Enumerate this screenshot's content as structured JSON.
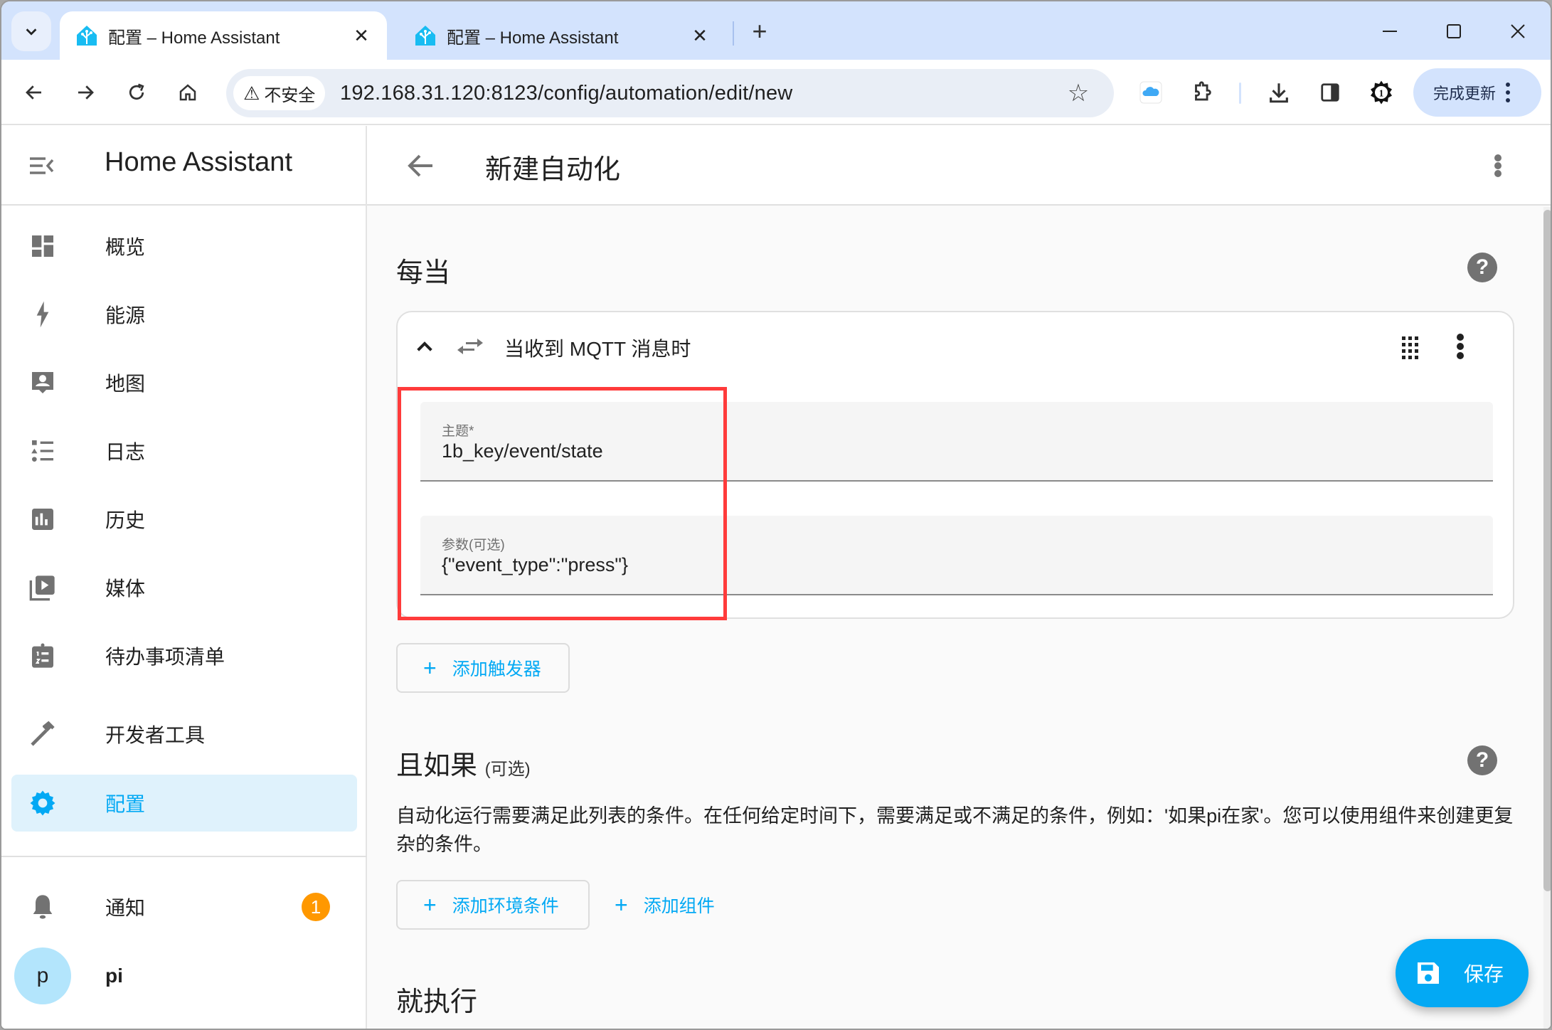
{
  "browser": {
    "tabs": [
      {
        "title": "配置 – Home Assistant",
        "active": true
      },
      {
        "title": "配置 – Home Assistant",
        "active": false
      }
    ],
    "new_tab_label": "+",
    "security_label": "不安全",
    "url": "192.168.31.120:8123/config/automation/edit/new",
    "update_button_label": "完成更新",
    "accent": "#d3e3fd"
  },
  "sidebar": {
    "title": "Home Assistant",
    "items": [
      {
        "label": "概览",
        "icon": "view-dashboard-icon"
      },
      {
        "label": "能源",
        "icon": "lightning-bolt-icon"
      },
      {
        "label": "地图",
        "icon": "account-box-map-icon"
      },
      {
        "label": "日志",
        "icon": "format-list-bulleted-type-icon"
      },
      {
        "label": "历史",
        "icon": "chart-box-icon"
      },
      {
        "label": "媒体",
        "icon": "play-box-multiple-icon"
      },
      {
        "label": "待办事项清单",
        "icon": "clipboard-list-icon"
      },
      {
        "label": "开发者工具",
        "icon": "hammer-icon"
      },
      {
        "label": "配置",
        "icon": "cog-icon",
        "selected": true
      }
    ],
    "notifications": {
      "label": "通知",
      "count": "1"
    },
    "user": {
      "initial": "p",
      "name": "pi"
    }
  },
  "main": {
    "title": "新建自动化",
    "triggers": {
      "heading": "每当",
      "card": {
        "title": "当收到 MQTT 消息时",
        "fields": [
          {
            "label": "主题*",
            "value": "1b_key/event/state"
          },
          {
            "label": "参数(可选)",
            "value": "{\"event_type\":\"press\"}"
          }
        ]
      },
      "add_button": "添加触发器"
    },
    "conditions": {
      "heading": "且如果",
      "heading_suffix": "(可选)",
      "description": "自动化运行需要满足此列表的条件。在任何给定时间下，需要满足或不满足的条件，例如：'如果pi在家'。您可以使用组件来创建更复杂的条件。",
      "add_condition_button": "添加环境条件",
      "add_block_button": "添加组件"
    },
    "actions": {
      "heading": "就执行"
    },
    "save_button": "保存",
    "primary_color": "#03a9f4",
    "highlight_color": "#ff3b3b"
  }
}
